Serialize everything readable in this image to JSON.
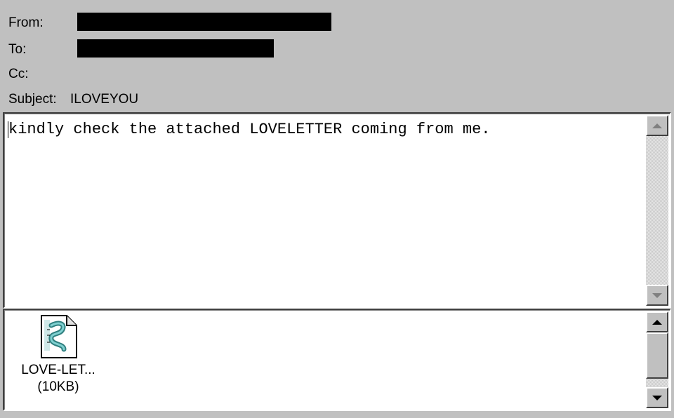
{
  "header": {
    "from_label": "From:",
    "to_label": "To:",
    "cc_label": "Cc:",
    "subject_label": "Subject:",
    "subject_value": "ILOVEYOU"
  },
  "body": {
    "text": "kindly check the attached LOVELETTER coming from me."
  },
  "attachment": {
    "name": "LOVE-LET...",
    "size": "(10KB)",
    "icon": "script-scroll-icon"
  },
  "colors": {
    "window_bg": "#c0c0c0",
    "pane_bg": "#ffffff",
    "redaction": "#000000",
    "icon_accent": "#4aa6a6"
  }
}
